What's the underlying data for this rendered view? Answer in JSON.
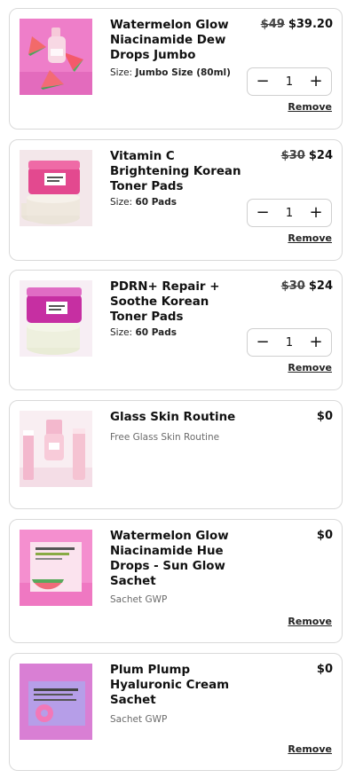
{
  "cart": {
    "items": [
      {
        "title": "Watermelon Glow Niacinamide Dew Drops Jumbo",
        "original_price": "$49",
        "price": "$39.20",
        "size_label": "Size:",
        "size_value": "Jumbo Size (80ml)",
        "quantity": "1",
        "remove_label": "Remove",
        "image_icon": "watermelon-dew-drops-image"
      },
      {
        "title": "Vitamin C Brightening Korean Toner Pads",
        "original_price": "$30",
        "price": "$24",
        "size_label": "Size:",
        "size_value": "60 Pads",
        "quantity": "1",
        "remove_label": "Remove",
        "image_icon": "vitamin-c-toner-pads-image"
      },
      {
        "title": "PDRN+ Repair + Soothe Korean Toner Pads",
        "original_price": "$30",
        "price": "$24",
        "size_label": "Size:",
        "size_value": "60 Pads",
        "quantity": "1",
        "remove_label": "Remove",
        "image_icon": "pdrn-toner-pads-image"
      },
      {
        "title": "Glass Skin Routine",
        "price": "$0",
        "subtitle": "Free Glass Skin Routine",
        "image_icon": "glass-skin-routine-image"
      },
      {
        "title": "Watermelon Glow Niacinamide Hue Drops - Sun Glow Sachet",
        "price": "$0",
        "subtitle": "Sachet GWP",
        "remove_label": "Remove",
        "image_icon": "hue-drops-sachet-image"
      },
      {
        "title": "Plum Plump Hyaluronic Cream Sachet",
        "price": "$0",
        "subtitle": "Sachet GWP",
        "remove_label": "Remove",
        "image_icon": "plum-plump-sachet-image"
      }
    ],
    "controls": {
      "minus_icon": "minus-icon",
      "plus_icon": "plus-icon"
    },
    "colors": {
      "border": "#d9d9d9",
      "text": "#111111",
      "muted": "#6b6b6b",
      "pink": "#e86fc0",
      "magenta": "#d43fa6"
    }
  }
}
